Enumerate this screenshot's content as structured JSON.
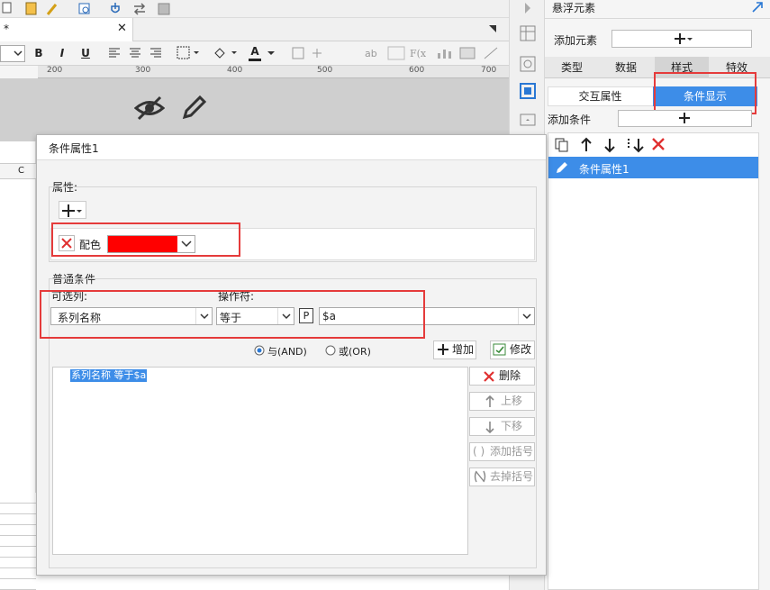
{
  "editor": {
    "tab_title": "*",
    "fmt": {
      "bold": "B",
      "italic": "I",
      "underline": "U",
      "font_color": "A"
    },
    "ruler_marks": [
      "200",
      "300",
      "400",
      "500",
      "600",
      "700"
    ],
    "column_header": "C"
  },
  "right_panel": {
    "title": "悬浮元素",
    "add_element_label": "添加元素",
    "tabs": [
      "类型",
      "数据",
      "样式",
      "特效"
    ],
    "subtabs": [
      "交互属性",
      "条件显示"
    ],
    "add_condition_label": "添加条件",
    "condition_items": [
      "条件属性1"
    ]
  },
  "dialog": {
    "title": "条件属性1",
    "attributes_label": "属性:",
    "attribute": {
      "name": "配色",
      "color": "#ff0000"
    },
    "normal_condition_label": "普通条件",
    "column_label": "可选列:",
    "column_value": "系列名称",
    "operator_label": "操作符:",
    "operator_value": "等于",
    "param_badge": "P",
    "value_text": "$a",
    "radio_and": "与(AND)",
    "radio_or": "或(OR)",
    "add_button": "增加",
    "modify_button": "修改",
    "delete_button": "删除",
    "move_up_button": "上移",
    "move_down_button": "下移",
    "add_bracket_button": "添加括号",
    "remove_bracket_button": "去掉括号",
    "condition_list": [
      "系列名称 等于$a"
    ]
  },
  "colors": {
    "accent": "#3d8de8",
    "highlight_box": "#e53b3b",
    "delete": "#e03030"
  }
}
